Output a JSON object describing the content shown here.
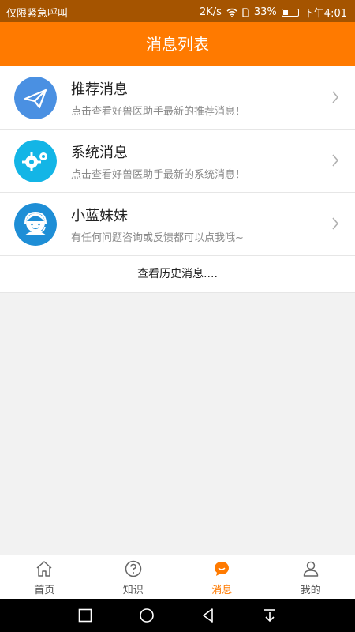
{
  "status_bar": {
    "left_text": "仅限紧急呼叫",
    "network_speed": "2K/s",
    "battery_percent": "33%",
    "time": "下午4:01"
  },
  "header": {
    "title": "消息列表"
  },
  "messages": [
    {
      "title": "推荐消息",
      "desc": "点击查看好兽医助手最新的推荐消息！",
      "icon": "paper-plane-icon",
      "color": "#4a90e2"
    },
    {
      "title": "系统消息",
      "desc": "点击查看好兽医助手最新的系统消息！",
      "icon": "gears-icon",
      "color": "#13b5e6"
    },
    {
      "title": "小蓝妹妹",
      "desc": "有任何问题咨询或反馈都可以点我哦~",
      "icon": "headset-agent-icon",
      "color": "#1e8ed6"
    }
  ],
  "history_link": "查看历史消息....",
  "tabs": [
    {
      "label": "首页",
      "icon": "home-icon",
      "active": false
    },
    {
      "label": "知识",
      "icon": "question-icon",
      "active": false
    },
    {
      "label": "消息",
      "icon": "message-icon",
      "active": true
    },
    {
      "label": "我的",
      "icon": "user-icon",
      "active": false
    }
  ],
  "colors": {
    "accent": "#ff7a00",
    "status_bar": "#a55400"
  }
}
